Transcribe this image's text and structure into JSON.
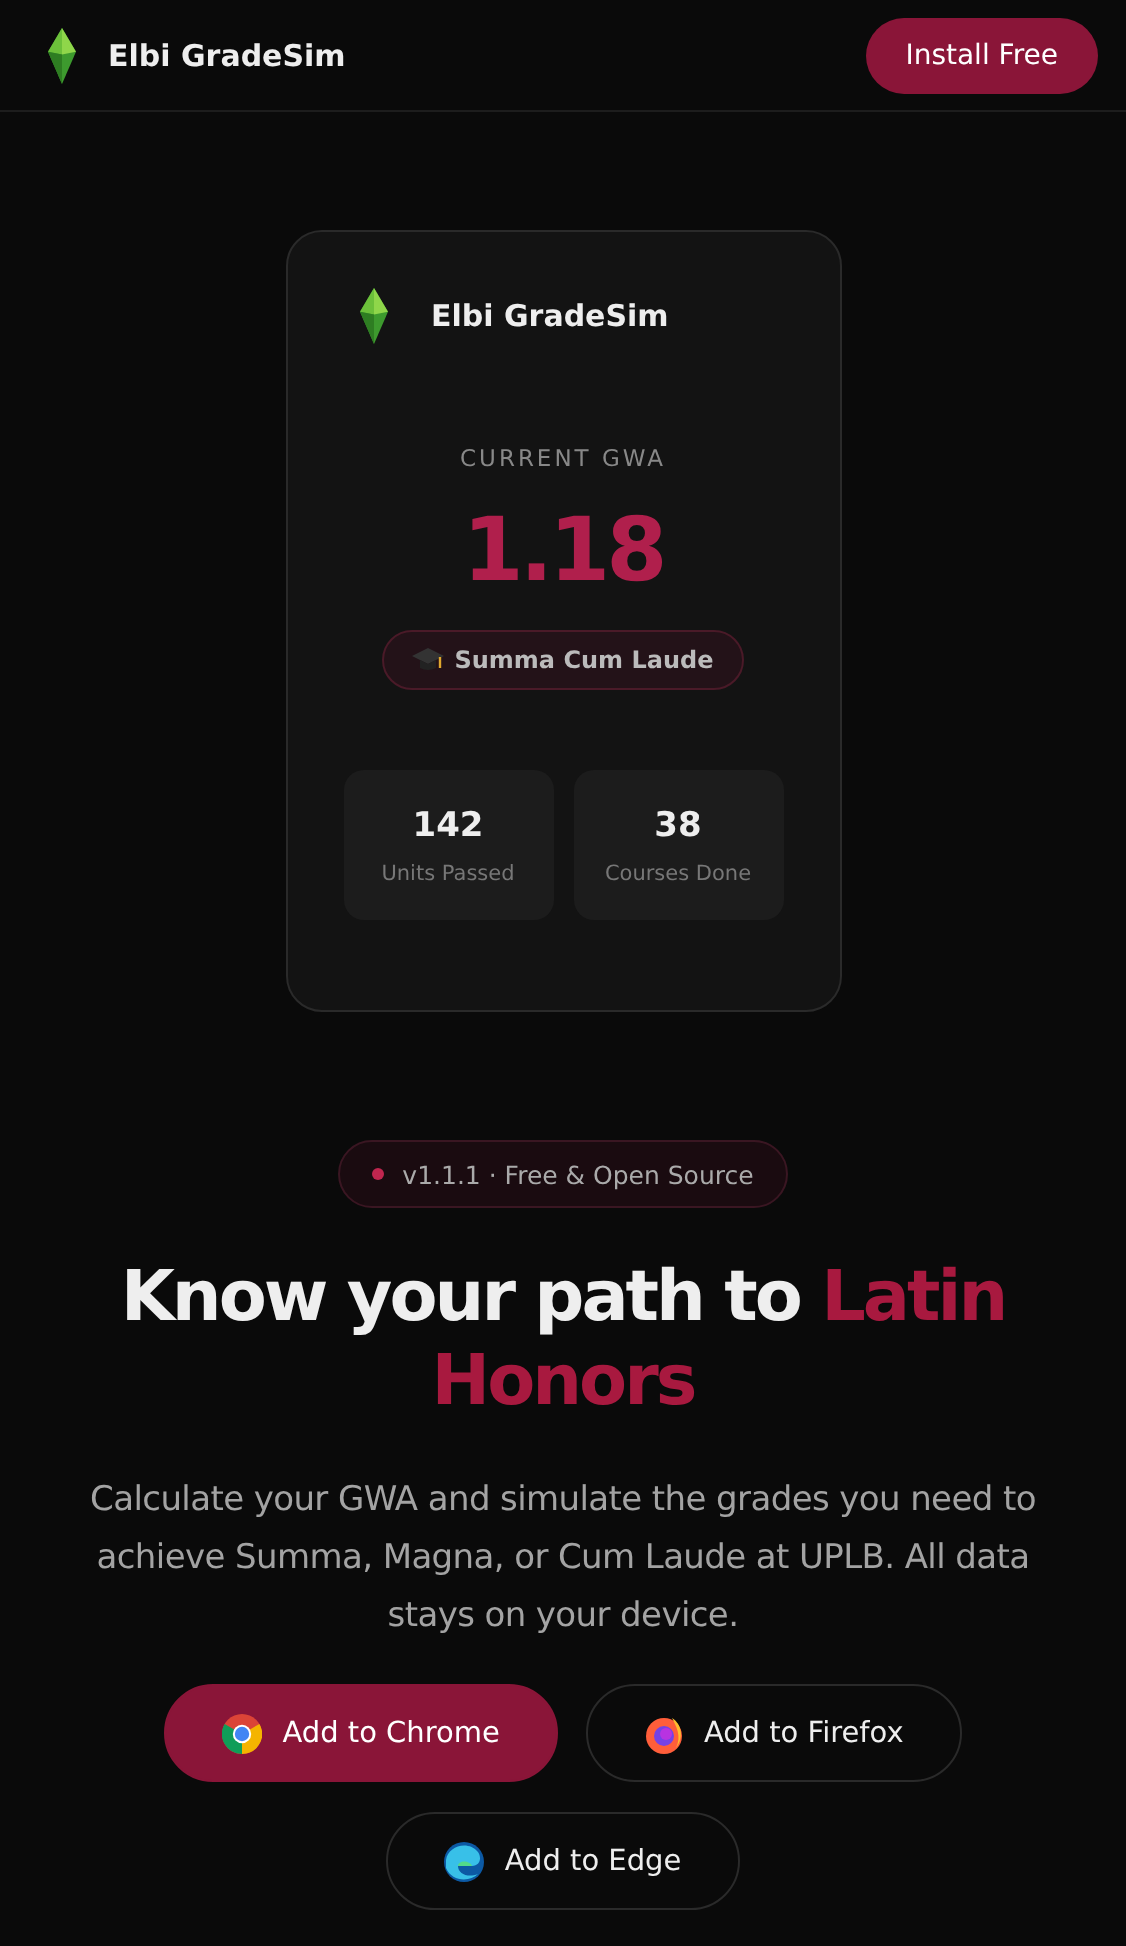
{
  "header": {
    "brand": "Elbi GradeSim",
    "install_button": "Install Free"
  },
  "preview_card": {
    "brand": "Elbi GradeSim",
    "label": "CURRENT GWA",
    "gwa": "1.18",
    "honor": "Summa Cum Laude",
    "stats": [
      {
        "value": "142",
        "label": "Units Passed"
      },
      {
        "value": "38",
        "label": "Courses Done"
      }
    ]
  },
  "release_pill": "v1.1.1 · Free & Open Source",
  "headline": {
    "lead": "Know your path to ",
    "accent": "Latin Honors"
  },
  "description": "Calculate your GWA and simulate the grades you need to achieve Summa, Magna, or Cum Laude at UPLB. All data stays on your device.",
  "buttons": [
    {
      "kind": "chrome",
      "label": "Add to Chrome",
      "primary": true
    },
    {
      "kind": "firefox",
      "label": "Add to Firefox",
      "primary": false
    },
    {
      "kind": "edge",
      "label": "Add to Edge",
      "primary": false
    }
  ]
}
